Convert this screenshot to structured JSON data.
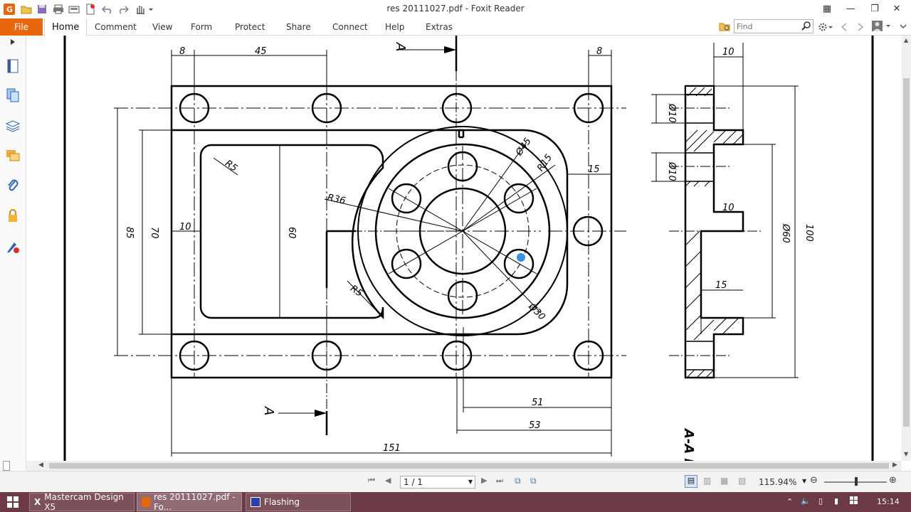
{
  "window": {
    "title": "res 20111027.pdf - Foxit Reader"
  },
  "ribbon": {
    "file": "File",
    "tabs": [
      "Home",
      "Comment",
      "View",
      "Form",
      "Protect",
      "Share",
      "Connect",
      "Help",
      "Extras"
    ]
  },
  "search": {
    "placeholder": "Find"
  },
  "drawing": {
    "section_marks": [
      "A",
      "A"
    ],
    "section_title": "A-A K",
    "dims": {
      "d8a": "8",
      "d45": "45",
      "d8b": "8",
      "d10top": "10",
      "dia10a": "Ø10",
      "dia10b": "Ø10",
      "d10mid": "10",
      "d15side": "15",
      "dia60": "Ø60",
      "d100": "100",
      "d85": "85",
      "d70": "70",
      "d10left": "10",
      "d60": "60",
      "r5a": "R5",
      "r5b": "R5",
      "r36": "R36",
      "dia45": "Ø45",
      "r15": "R15",
      "d15": "15",
      "dia30": "Ø30",
      "d51": "51",
      "d53": "53",
      "d151": "151"
    }
  },
  "statusbar": {
    "page": "1 / 1",
    "zoom": "115.94%"
  },
  "taskbar": {
    "items": [
      "Mastercam Design X5",
      "res 20111027.pdf - Fo...",
      "Flashing"
    ],
    "time": "15:14"
  },
  "colors": {
    "accent": "#e8660c",
    "taskbar": "#6b3a44"
  }
}
